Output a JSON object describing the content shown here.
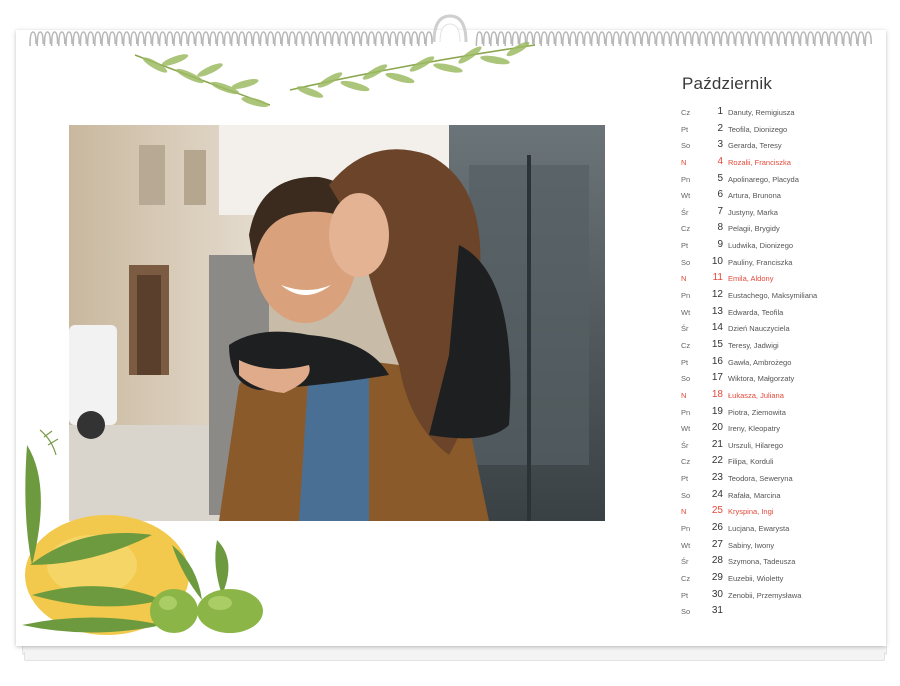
{
  "calendar": {
    "month": "Październik",
    "days": [
      {
        "wd": "Cz",
        "n": "1",
        "names": "Danuty, Remigiusza",
        "holiday": false
      },
      {
        "wd": "Pt",
        "n": "2",
        "names": "Teofila, Dionizego",
        "holiday": false
      },
      {
        "wd": "So",
        "n": "3",
        "names": "Gerarda, Teresy",
        "holiday": false
      },
      {
        "wd": "N",
        "n": "4",
        "names": "Rozalii, Franciszka",
        "holiday": true
      },
      {
        "wd": "Pn",
        "n": "5",
        "names": "Apolinarego, Placyda",
        "holiday": false
      },
      {
        "wd": "Wt",
        "n": "6",
        "names": "Artura, Brunona",
        "holiday": false
      },
      {
        "wd": "Śr",
        "n": "7",
        "names": "Justyny, Marka",
        "holiday": false
      },
      {
        "wd": "Cz",
        "n": "8",
        "names": "Pelagii, Brygidy",
        "holiday": false
      },
      {
        "wd": "Pt",
        "n": "9",
        "names": "Ludwika, Dionizego",
        "holiday": false
      },
      {
        "wd": "So",
        "n": "10",
        "names": "Pauliny, Franciszka",
        "holiday": false
      },
      {
        "wd": "N",
        "n": "11",
        "names": "Emila, Aldony",
        "holiday": true
      },
      {
        "wd": "Pn",
        "n": "12",
        "names": "Eustachego, Maksymiliana",
        "holiday": false
      },
      {
        "wd": "Wt",
        "n": "13",
        "names": "Edwarda, Teofila",
        "holiday": false
      },
      {
        "wd": "Śr",
        "n": "14",
        "names": "Dzień Nauczyciela",
        "holiday": false
      },
      {
        "wd": "Cz",
        "n": "15",
        "names": "Teresy, Jadwigi",
        "holiday": false
      },
      {
        "wd": "Pt",
        "n": "16",
        "names": "Gawła, Ambrożego",
        "holiday": false
      },
      {
        "wd": "So",
        "n": "17",
        "names": "Wiktora, Małgorzaty",
        "holiday": false
      },
      {
        "wd": "N",
        "n": "18",
        "names": "Łukasza, Juliana",
        "holiday": true
      },
      {
        "wd": "Pn",
        "n": "19",
        "names": "Piotra, Ziemowita",
        "holiday": false
      },
      {
        "wd": "Wt",
        "n": "20",
        "names": "Ireny, Kleopatry",
        "holiday": false
      },
      {
        "wd": "Śr",
        "n": "21",
        "names": "Urszuli, Hilarego",
        "holiday": false
      },
      {
        "wd": "Cz",
        "n": "22",
        "names": "Filipa, Korduli",
        "holiday": false
      },
      {
        "wd": "Pt",
        "n": "23",
        "names": "Teodora, Seweryna",
        "holiday": false
      },
      {
        "wd": "So",
        "n": "24",
        "names": "Rafała, Marcina",
        "holiday": false
      },
      {
        "wd": "N",
        "n": "25",
        "names": "Kryspina, Ingi",
        "holiday": true
      },
      {
        "wd": "Pn",
        "n": "26",
        "names": "Lucjana, Ewarysta",
        "holiday": false
      },
      {
        "wd": "Wt",
        "n": "27",
        "names": "Sabiny, Iwony",
        "holiday": false
      },
      {
        "wd": "Śr",
        "n": "28",
        "names": "Szymona, Tadeusza",
        "holiday": false
      },
      {
        "wd": "Cz",
        "n": "29",
        "names": "Euzebii, Wioletty",
        "holiday": false
      },
      {
        "wd": "Pt",
        "n": "30",
        "names": "Zenobii, Przemysława",
        "holiday": false
      },
      {
        "wd": "So",
        "n": "31",
        "names": "",
        "holiday": false
      }
    ]
  },
  "photo": {
    "description_icon": "couple-photo"
  },
  "colors": {
    "holiday": "#e24a3b",
    "leaf_green": "#7fa858",
    "olive_green": "#9dba5a",
    "lemon_yellow": "#f2c94c"
  }
}
